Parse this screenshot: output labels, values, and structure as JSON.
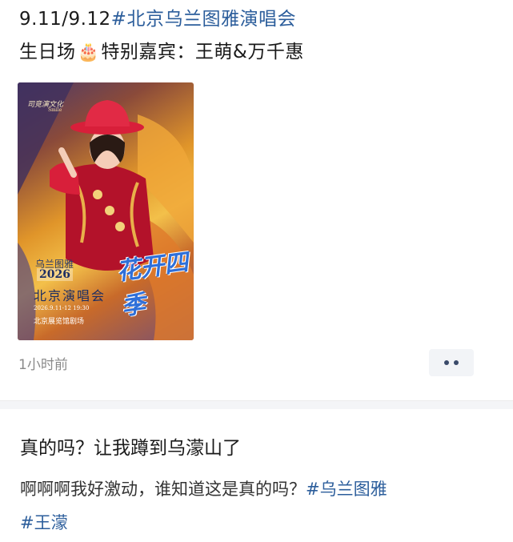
{
  "post": {
    "date_range": "9.11/9.12",
    "hashtag_concert": "#北京乌兰图雅演唱会",
    "line2_prefix": "生日场",
    "cake_icon": "🎂",
    "line2_suffix": "特别嘉宾：王萌&万千惠",
    "time": "1小时前"
  },
  "poster": {
    "brand": "司竞演文化",
    "brand_sub": "Smile",
    "series": "乌兰图雅",
    "year": "2026",
    "script_title": "花开四季",
    "title": "北京演唱会",
    "date": "2026.9.11-12 19:30",
    "venue": "北京展览馆剧场"
  },
  "comment": {
    "title": "真的吗？让我蹲到乌濛山了",
    "body": "啊啊啊我好激动，谁知道这是真的吗？",
    "hashtag1": "#乌兰图雅",
    "hashtag2": "#王濛"
  },
  "colors": {
    "hashtag": "#2b5d9b",
    "divider": "#f4f5f7",
    "more_button_bg": "#f2f4f7"
  }
}
